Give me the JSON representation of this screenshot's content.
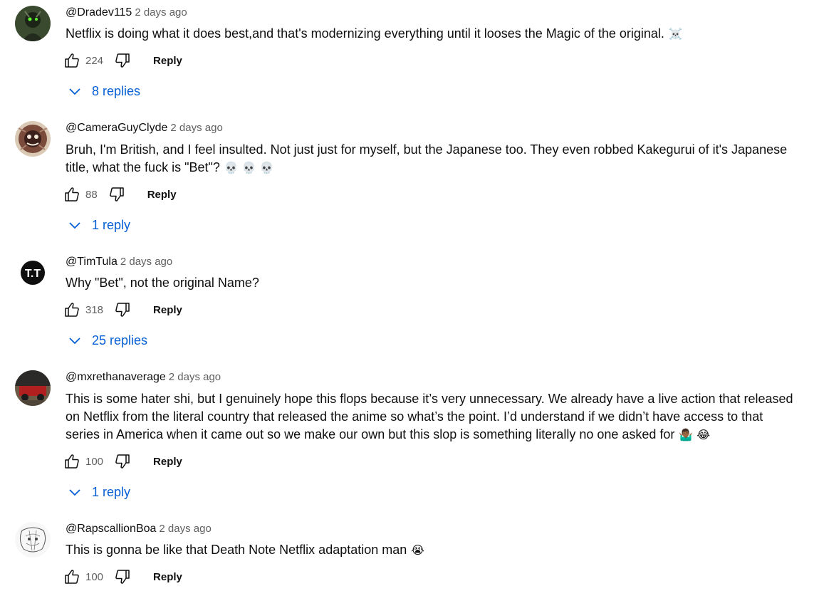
{
  "comments": [
    {
      "author": "@Dradev115",
      "time": "2 days ago",
      "text": "Netflix is doing what it does best,and that's modernizing everything until it looses the Magic  of the original.",
      "emoji": "☠️",
      "likes": "224",
      "reply_label": "Reply",
      "replies": "8 replies"
    },
    {
      "author": "@CameraGuyClyde",
      "time": "2 days ago",
      "text": "Bruh, I'm British, and I feel insulted. Not just just for myself, but the Japanese too. They even robbed Kakegurui of it's Japanese title, what the fuck is \"Bet\"?",
      "emoji": "💀 💀 💀",
      "likes": "88",
      "reply_label": "Reply",
      "replies": "1 reply"
    },
    {
      "author": "@TimTula",
      "time": "2 days ago",
      "text": "Why \"Bet\", not the original Name?",
      "emoji": "",
      "avatar_text": "T.T",
      "likes": "318",
      "reply_label": "Reply",
      "replies": "25 replies"
    },
    {
      "author": "@mxrethanaverage",
      "time": "2 days ago",
      "text": "This is some hater shi, but I genuinely hope this flops because it’s very unnecessary. We already have a live action that released on Netflix from the literal country that released the anime so what’s the point. I’d understand if we didn’t have access to that series in America when it came out so we make our own but this slop is something literally no one asked for",
      "emoji": "🤷🏾‍♂️ 😂",
      "likes": "100",
      "reply_label": "Reply",
      "replies": "1 reply"
    },
    {
      "author": "@RapscallionBoa",
      "time": "2 days ago",
      "text": "This is gonna be like that Death Note Netflix adaptation man",
      "emoji": "😭",
      "likes": "100",
      "reply_label": "Reply",
      "replies": ""
    }
  ],
  "colors": {
    "link_blue": "#065fd4",
    "secondary_text": "#606060",
    "primary_text": "#0f0f0f"
  },
  "icons": {
    "like": "thumbs-up-icon",
    "dislike": "thumbs-down-icon",
    "expand": "chevron-down-icon"
  }
}
